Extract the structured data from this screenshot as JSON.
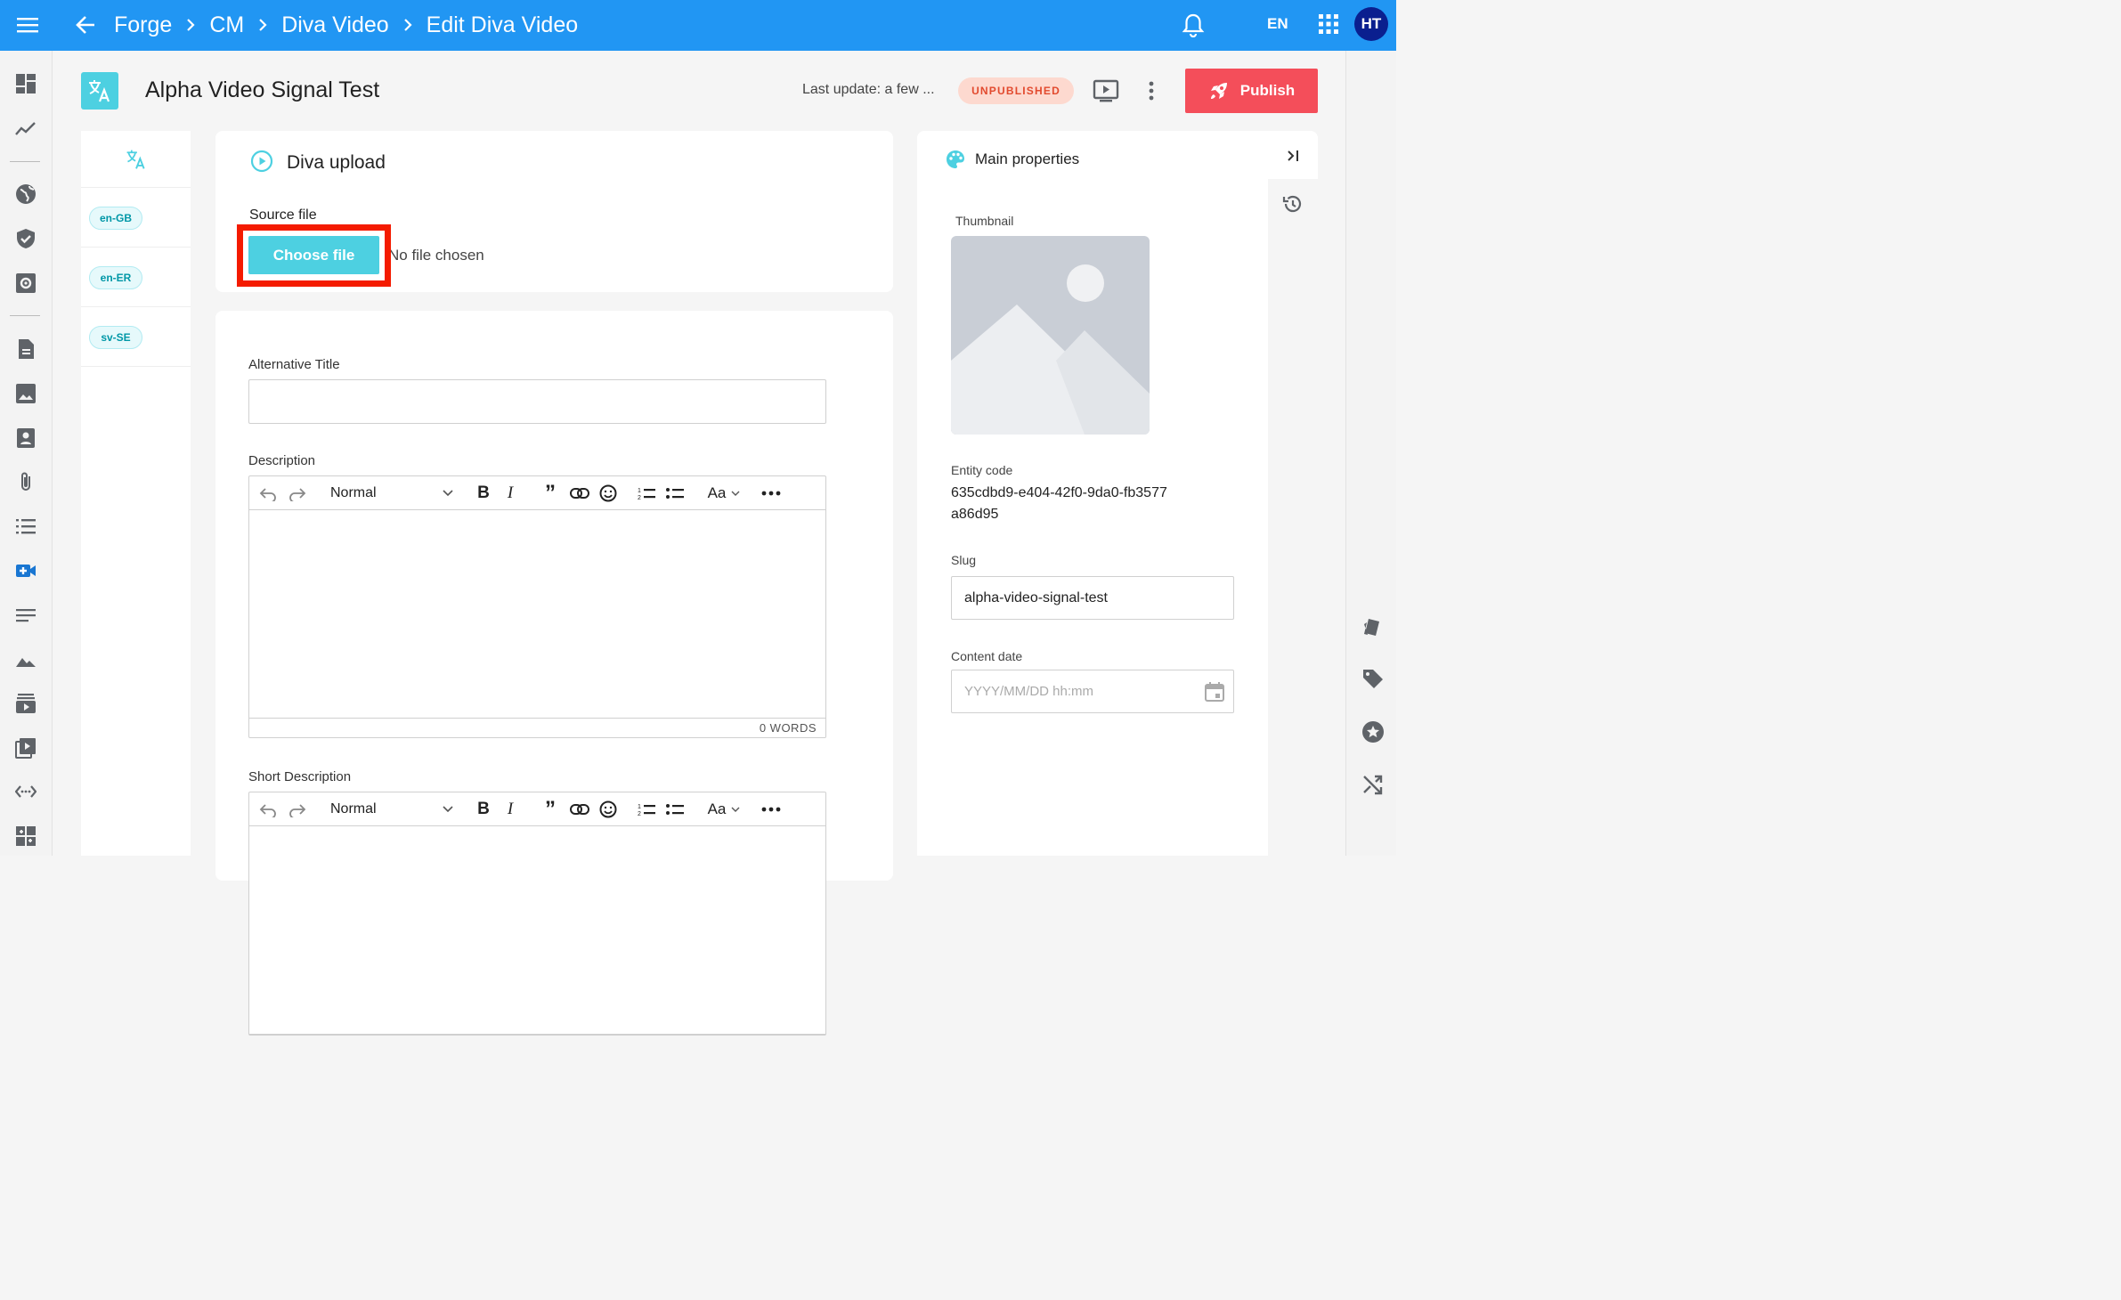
{
  "colors": {
    "topbar": "#2196f3",
    "accent": "#4dd0e1",
    "publish": "#f44e5a",
    "status_bg": "#fdd9cf",
    "status_text": "#e24a2e",
    "highlight": "#f41b00",
    "avatar": "#0a1f8f"
  },
  "topbar": {
    "breadcrumbs": [
      "Forge",
      "CM",
      "Diva Video",
      "Edit Diva Video"
    ],
    "language": "EN",
    "avatar_initials": "HT",
    "icons": [
      "menu-icon",
      "arrow-back-icon",
      "bell-icon",
      "apps-grid-icon"
    ]
  },
  "header": {
    "title": "Alpha Video Signal Test",
    "last_update": "Last update: a few ...",
    "status": "UNPUBLISHED",
    "publish_label": "Publish"
  },
  "locales": [
    "en-GB",
    "en-ER",
    "sv-SE"
  ],
  "upload": {
    "title": "Diva upload",
    "source_label": "Source file",
    "choose_label": "Choose file",
    "no_file": "No file chosen"
  },
  "form": {
    "alt_title_label": "Alternative Title",
    "alt_title_value": "",
    "description_label": "Description",
    "short_description_label": "Short Description",
    "editor_style": "Normal",
    "word_count": "0 WORDS"
  },
  "properties": {
    "title": "Main properties",
    "thumbnail_label": "Thumbnail",
    "entity_code_label": "Entity code",
    "entity_code": "635cdbd9-e404-42f0-9da0-fb3577a86d95",
    "slug_label": "Slug",
    "slug_value": "alpha-video-signal-test",
    "content_date_label": "Content date",
    "content_date_placeholder": "YYYY/MM/DD hh:mm"
  }
}
